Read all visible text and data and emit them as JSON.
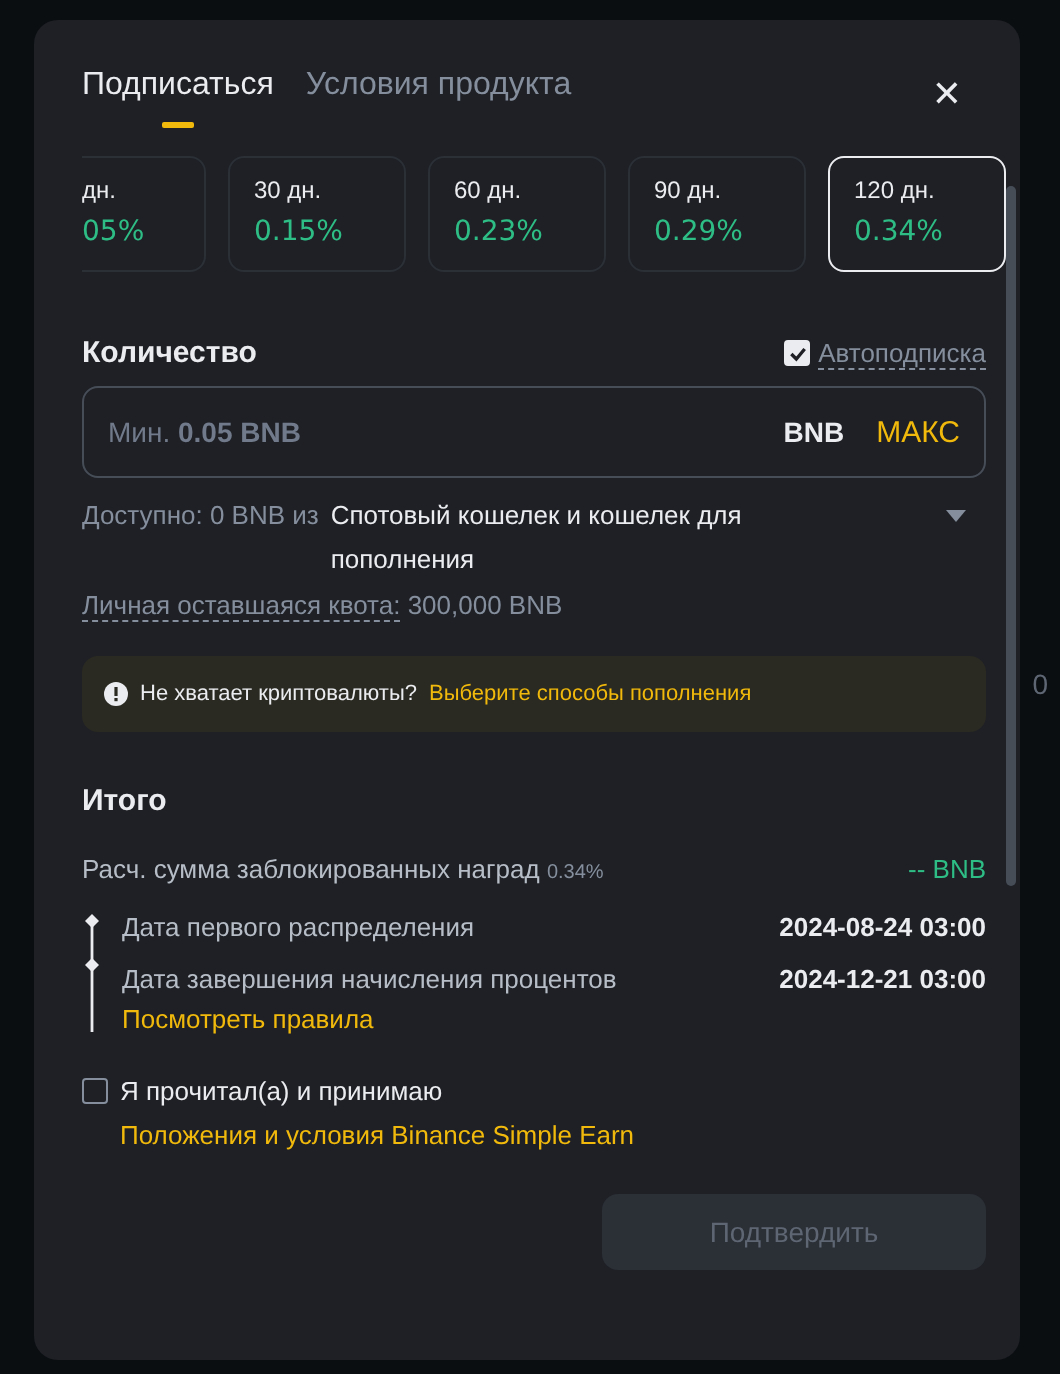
{
  "background": {
    "fragments": [
      "0"
    ]
  },
  "tabs": [
    {
      "label": "Подписаться",
      "selected": true
    },
    {
      "label": "Условия продукта",
      "selected": false
    }
  ],
  "close": "✕",
  "terms": [
    {
      "duration": "дн.",
      "apr": "05%",
      "selected": false,
      "partial": true
    },
    {
      "duration": "30 дн.",
      "apr": "0.15%",
      "selected": false,
      "partial": false
    },
    {
      "duration": "60 дн.",
      "apr": "0.23%",
      "selected": false,
      "partial": false
    },
    {
      "duration": "90 дн.",
      "apr": "0.29%",
      "selected": false,
      "partial": false
    },
    {
      "duration": "120 дн.",
      "apr": "0.34%",
      "selected": true,
      "partial": false
    }
  ],
  "amount": {
    "title": "Количество",
    "auto_subscribe": {
      "label": "Автоподписка",
      "checked": true
    },
    "placeholder": "Мин. **0.05 BNB**",
    "currency": "BNB",
    "max": "МАКС"
  },
  "available": {
    "label": "Доступно: 0 BNB из",
    "wallet": "Спотовый кошелек и кошелек для пополнения"
  },
  "quota": {
    "label": "Личная оставшаяся квота:",
    "value": "300,000 BNB"
  },
  "notice": {
    "text": "Не хватает криптовалюты?",
    "link": "Выберите способы пополнения"
  },
  "summary": {
    "title": "Итого",
    "rewards_label": "Расч. сумма заблокированных наград",
    "rewards_rate": "0.34%",
    "rewards_value": "-- BNB",
    "timeline": [
      {
        "label": "Дата первого распределения",
        "value": "2024-08-24 03:00"
      },
      {
        "label": "Дата завершения начисления процентов",
        "value": "2024-12-21 03:00"
      }
    ],
    "rules_link": "Посмотреть правила"
  },
  "agreement": {
    "checked": false,
    "text": "Я прочитал(а) и принимаю",
    "link": "Положения и условия Binance Simple Earn"
  },
  "confirm": {
    "label": "Подтвердить",
    "disabled": true
  }
}
